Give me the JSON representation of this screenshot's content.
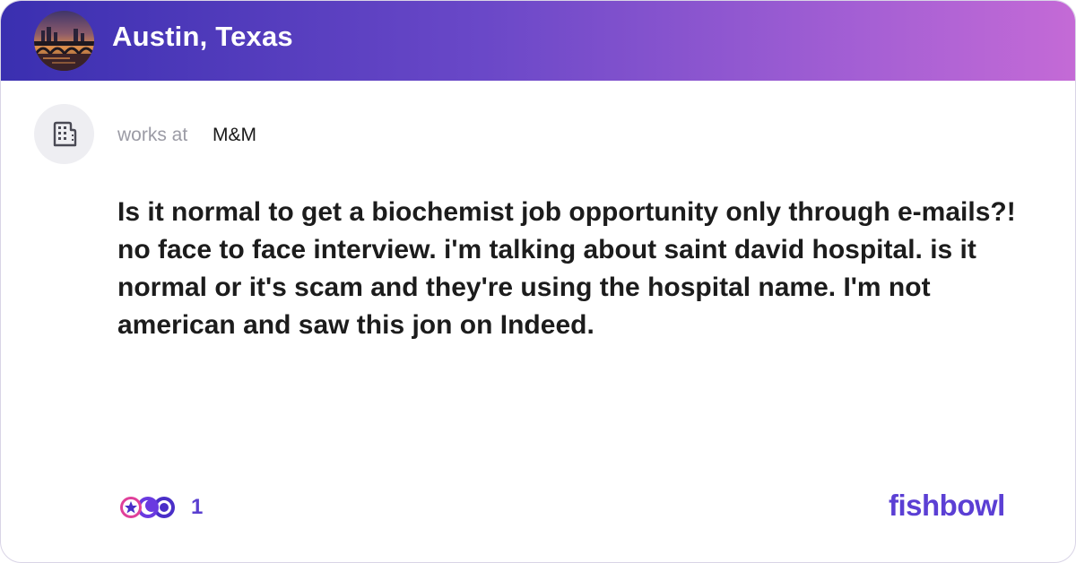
{
  "bowl": {
    "title": "Austin, Texas",
    "avatar_icon": "austin-skyline-bridge-photo"
  },
  "author": {
    "works_label": "works at",
    "company": "M&M",
    "avatar_icon": "building-icon"
  },
  "post": {
    "text": "Is it normal to get a biochemist job opportunity only through e-mails?! no face to face interview. i'm talking about saint david hospital. is it normal or it's scam and they're using the hospital name. I'm not american and saw this jon on Indeed."
  },
  "reactions": {
    "count": "1",
    "icons": [
      "star-reaction-icon",
      "moon-reaction-icon",
      "clap-reaction-icon"
    ]
  },
  "brand": {
    "logo_text": "fishbowl"
  },
  "colors": {
    "header_gradient_start": "#3a2fb0",
    "header_gradient_end": "#c46ad6",
    "brand": "#5b3fd4",
    "reaction_count": "#5a3fd0"
  }
}
